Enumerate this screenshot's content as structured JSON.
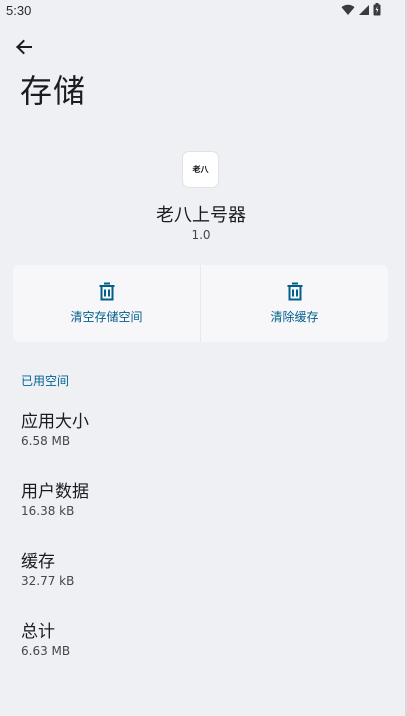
{
  "status_bar": {
    "time": "5:30",
    "icons": [
      "wifi-icon",
      "signal-icon",
      "battery-icon"
    ]
  },
  "toolbar": {
    "back_icon": "arrow-back-icon",
    "title": "存储"
  },
  "app": {
    "icon_text": "老八",
    "name": "老八上号器",
    "version": "1.0"
  },
  "actions": [
    {
      "label": "清空存储空间",
      "icon": "trash-icon"
    },
    {
      "label": "清除缓存",
      "icon": "trash-icon"
    }
  ],
  "section": {
    "header": "已用空间"
  },
  "storage_items": [
    {
      "title": "应用大小",
      "value": "6.58 MB"
    },
    {
      "title": "用户数据",
      "value": "16.38 kB"
    },
    {
      "title": "缓存",
      "value": "32.77 kB"
    },
    {
      "title": "总计",
      "value": "6.63 MB"
    }
  ],
  "colors": {
    "background": "#eff0f4",
    "accent": "#005f8b",
    "card": "#f7f7fa"
  }
}
